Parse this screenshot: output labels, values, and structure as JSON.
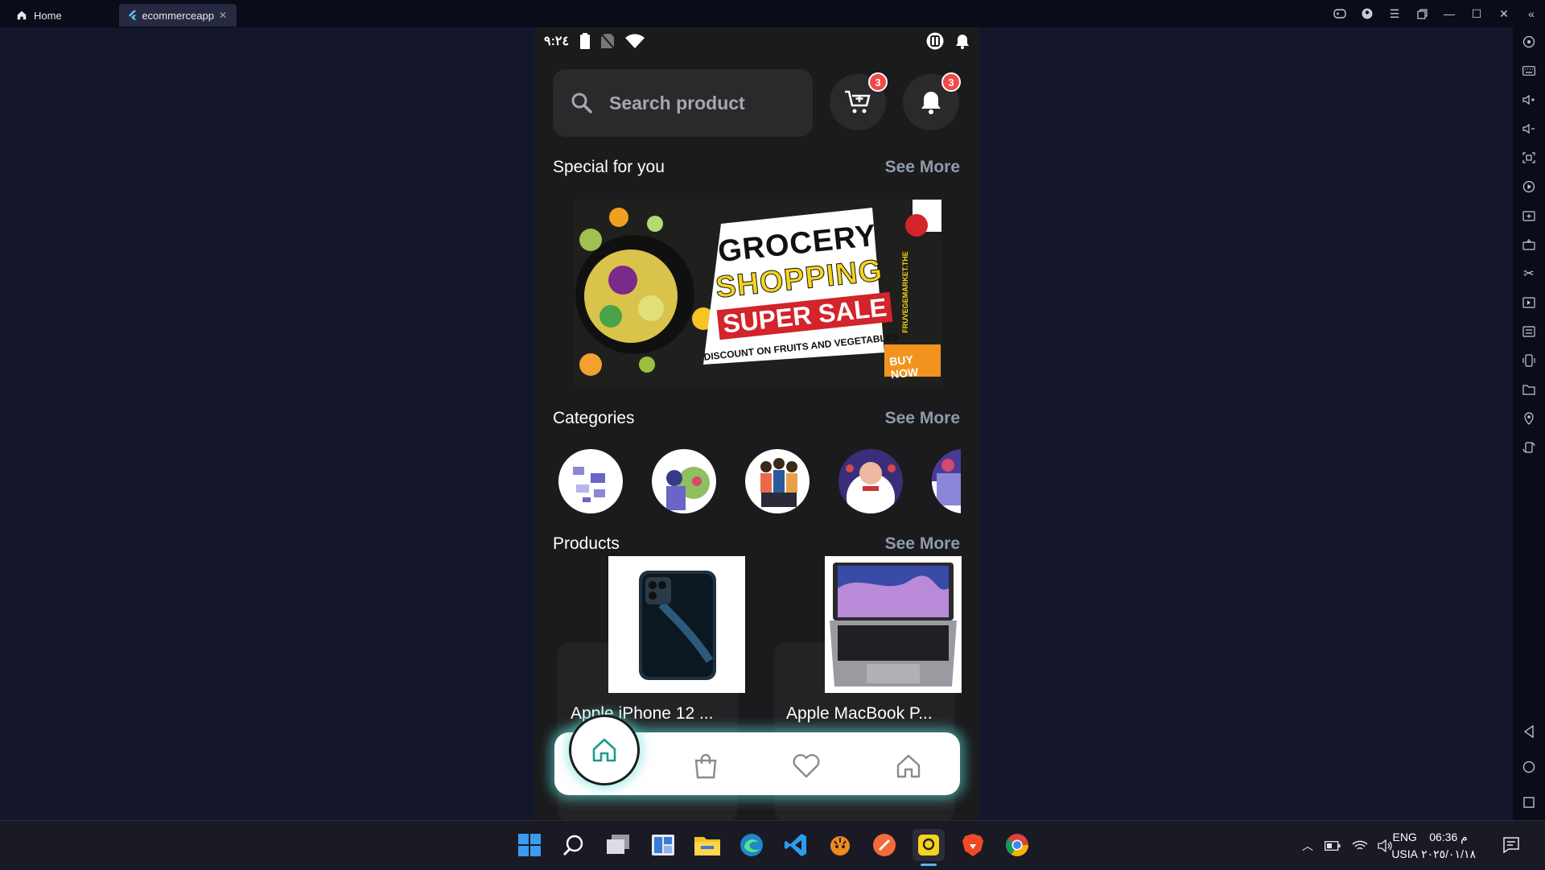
{
  "window": {
    "tabs": [
      {
        "label": "Home"
      },
      {
        "label": "ecommerceapp"
      }
    ]
  },
  "phone": {
    "status_time": "٩:٢٤",
    "search": {
      "placeholder": "Search product"
    },
    "cart_badge": "3",
    "notification_badge": "3",
    "sections": {
      "special": {
        "title": "Special for you",
        "see_more": "See More"
      },
      "categories": {
        "title": "Categories",
        "see_more": "See More"
      },
      "products": {
        "title": "Products",
        "see_more": "See More"
      }
    },
    "banner": {
      "line1": "GROCERY",
      "line2": "SHOPPING",
      "line3": "SUPER SALE",
      "line4": "DISCOUNT ON FRUITS AND VEGETABLES",
      "cta": "BUY NOW",
      "side": "FRUVEGEMARKET.THE"
    },
    "products": [
      {
        "name": "Apple iPhone 12 ..."
      },
      {
        "name": "Apple MacBook P..."
      }
    ]
  },
  "taskbar": {
    "lang_top": "ENG",
    "lang_bottom": "USIA",
    "time": "06:36 م",
    "date": "٢٠٢٥/٠١/١٨"
  },
  "colors": {
    "badge": "#f24848",
    "see_more": "#8e9bab",
    "accent_teal": "#1a9c8c",
    "phone_bg": "#1b1b1d",
    "emulator_bg": "#14162b"
  }
}
